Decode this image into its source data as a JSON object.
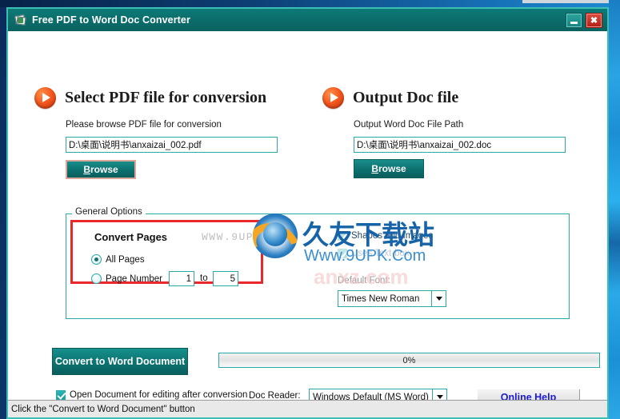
{
  "window": {
    "title": "Free PDF to Word Doc Converter",
    "icon": "app-document-icon",
    "minimize_label": "",
    "close_label": "✖"
  },
  "left_panel": {
    "heading": "Select PDF file for conversion",
    "sub_label": "Please browse PDF file for conversion",
    "input_value": "D:\\桌面\\说明书\\anxaizai_002.pdf",
    "browse_label_prefix": "B",
    "browse_label_rest": "rowse"
  },
  "right_panel": {
    "heading": "Output Doc file",
    "sub_label": "Output Word Doc File Path",
    "input_value": "D:\\桌面\\说明书\\anxaizai_002.doc",
    "browse_label_prefix": "B",
    "browse_label_rest": "rowse"
  },
  "general_options": {
    "legend": "General Options",
    "convert_pages_title": "Convert Pages",
    "all_pages_label": "All Pages",
    "all_pages_selected": true,
    "page_number_label": "Page Number",
    "page_number_selected": false,
    "page_from": "1",
    "to_label": "to",
    "page_to": "5",
    "shapes_images_label": "Shapes and Images",
    "shapes_images_checked": true,
    "uses_textbox_label": "Uses Text-box",
    "uses_textbox_checked": true,
    "default_font_label": "Default Font:",
    "default_font_value": "Times New Roman"
  },
  "watermark": {
    "ghost_url": "WWW.9UPK.COM",
    "cn_text": "久友下载站",
    "url_text": "Www.9UPK.Com",
    "faint_text": "anxz.com"
  },
  "bottom": {
    "convert_label": "Convert to Word Document",
    "progress_text": "0%",
    "open_doc_label": "Open Document for editing after conversion",
    "open_doc_checked": true,
    "doc_reader_label": "Doc Reader:",
    "doc_reader_value": "Windows Default (MS Word)",
    "help_label": "Online Help"
  },
  "statusbar": {
    "text": "Click the \"Convert to Word Document\" button"
  },
  "colors": {
    "teal_dark": "#0b6e6c",
    "teal_border": "#2ba8a8",
    "accent_orange": "#f4591f",
    "highlight_red": "#e8282b",
    "link_blue": "#1b1bd6"
  }
}
